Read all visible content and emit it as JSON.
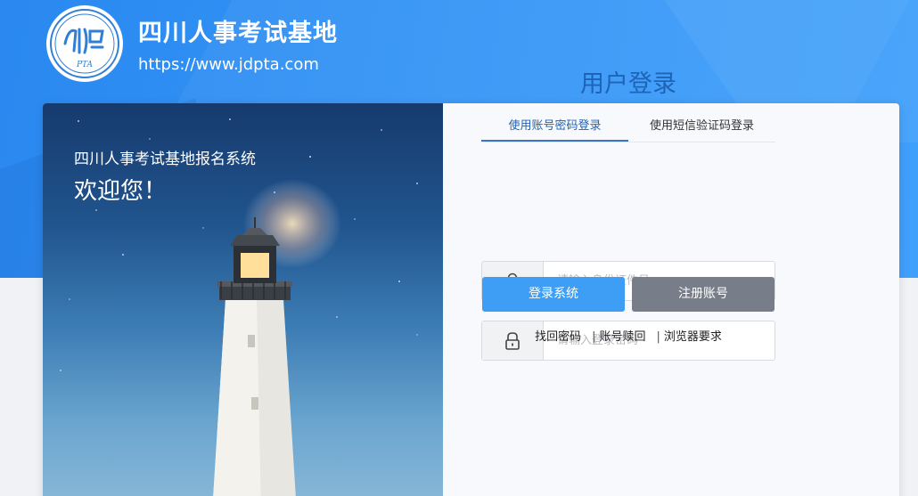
{
  "header": {
    "logo_text": "PTA",
    "title": "四川人事考试基地",
    "url": "https://www.jdpta.com"
  },
  "banner": {
    "subtitle": "四川人事考试基地报名系统",
    "welcome": "欢迎您！"
  },
  "login": {
    "title": "用户登录",
    "tabs": [
      {
        "label": "使用账号密码登录",
        "active": true
      },
      {
        "label": "使用短信验证码登录",
        "active": false
      }
    ],
    "id_field": {
      "icon": "user-icon",
      "placeholder": "请输入身份证件号",
      "value": ""
    },
    "password_field": {
      "icon": "lock-icon",
      "placeholder": "请输入登录密码",
      "value": ""
    },
    "login_button": "登录系统",
    "register_button": "注册账号",
    "links": {
      "recover": "找回密码",
      "sep": "|",
      "account_help": "账号赎回",
      "browser": "浏览器要求"
    }
  },
  "colors": {
    "header_blue": "#3394f5",
    "title_blue": "#1e63b6",
    "login_button": "#3e9ef6",
    "register_button": "#787d8a"
  }
}
